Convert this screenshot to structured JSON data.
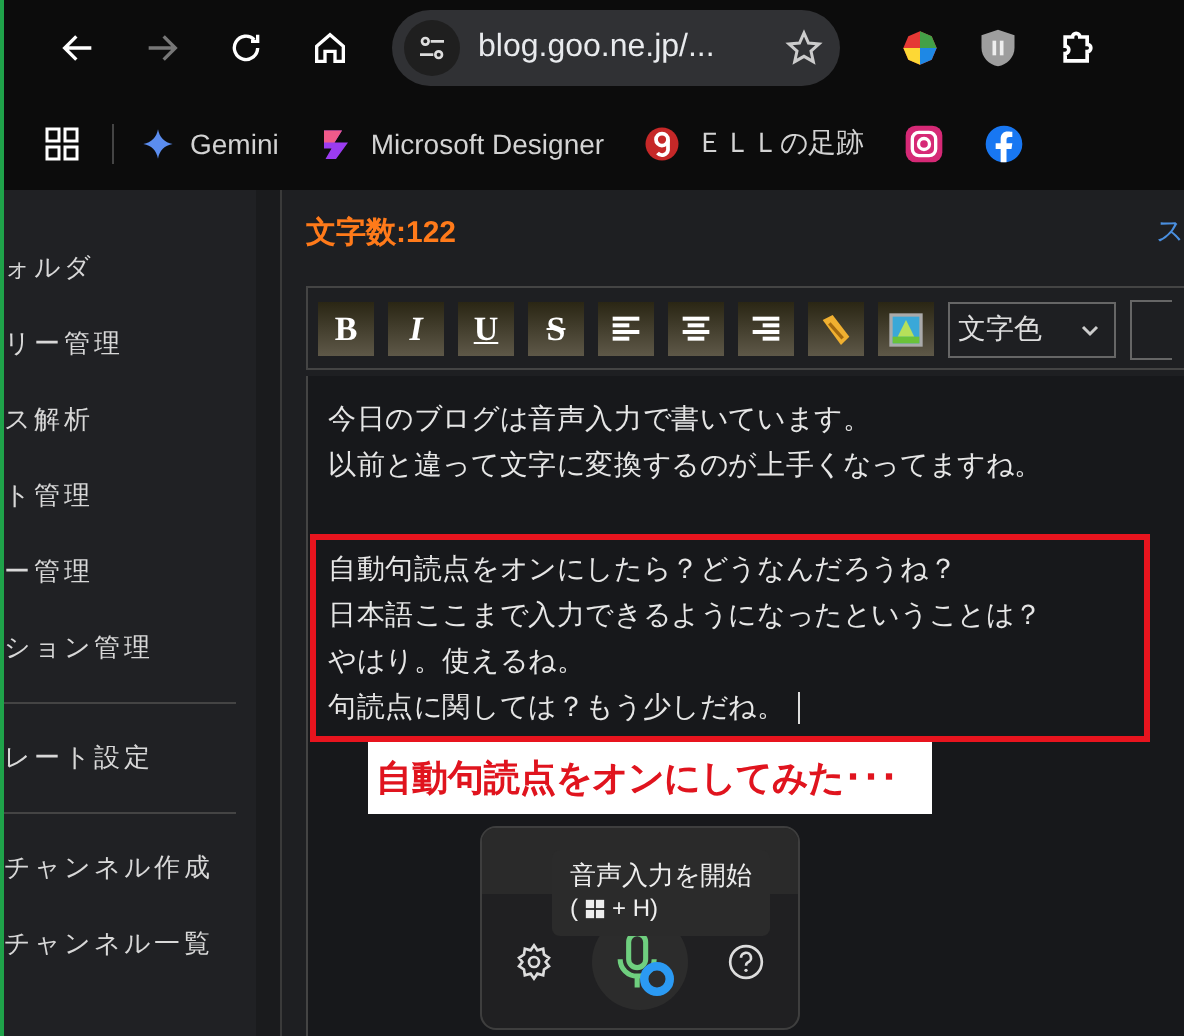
{
  "browser": {
    "address": "blog.goo.ne.jp/...",
    "bookmarks": [
      {
        "label": "Gemini",
        "kind": "gemini"
      },
      {
        "label": "Microsoft Designer",
        "kind": "designer"
      },
      {
        "label": "ＥＬＬの足跡",
        "kind": "goo"
      },
      {
        "kind": "instagram"
      },
      {
        "kind": "facebook"
      }
    ]
  },
  "sidebar": {
    "groups": [
      [
        "ォルダ",
        "リー管理",
        "ス解析",
        "ト管理",
        "ー管理",
        "ション管理"
      ],
      [
        "レート設定"
      ],
      [
        "チャンネル作成",
        "チャンネル一覧"
      ]
    ]
  },
  "editor": {
    "char_count": "文字数:122",
    "link": "ス",
    "toolbar": [
      {
        "kind": "bold",
        "label": "B"
      },
      {
        "kind": "italic",
        "label": "I"
      },
      {
        "kind": "underline",
        "label": "U"
      },
      {
        "kind": "strike",
        "label": "S"
      },
      {
        "kind": "align-left"
      },
      {
        "kind": "align-center"
      },
      {
        "kind": "align-right"
      },
      {
        "kind": "link"
      },
      {
        "kind": "image"
      }
    ],
    "color_select": "文字色",
    "paragraphs": [
      {
        "highlighted": false,
        "lines": [
          "今日のブログは音声入力で書いています。",
          "以前と違って文字に変換するのが上手くなってますね。"
        ]
      },
      {
        "highlighted": true,
        "lines": [
          "自動句読点をオンにしたら？どうなんだろうね？",
          "日本語ここまで入力できるようになったということは？",
          "やはり。使えるね。",
          "句読点に関しては？もう少しだね。"
        ]
      }
    ],
    "annotation": "自動句読点をオンにしてみた･･･"
  },
  "voice_typing": {
    "tooltip_title": "音声入力を開始",
    "shortcut_prefix": "(",
    "shortcut_suffix": "+ H)"
  }
}
